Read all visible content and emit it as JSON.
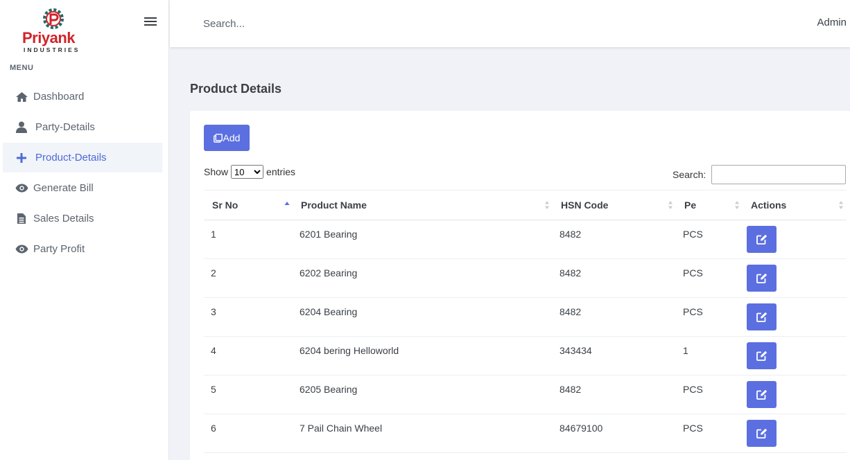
{
  "brand": {
    "name": "Priyank",
    "tagline": "INDUSTRIES",
    "primary_color": "#d1232a",
    "gear_color": "#1d6b6b"
  },
  "sidebar": {
    "menu_title": "MENU",
    "items": [
      {
        "label": "Dashboard",
        "icon": "home-icon",
        "active": false
      },
      {
        "label": "Party-Details",
        "icon": "user-icon",
        "active": false
      },
      {
        "label": "Product-Details",
        "icon": "plus-icon",
        "active": true
      },
      {
        "label": "Generate Bill",
        "icon": "eye-icon",
        "active": false
      },
      {
        "label": "Sales Details",
        "icon": "file-icon",
        "active": false
      },
      {
        "label": "Party Profit",
        "icon": "eye-icon",
        "active": false
      }
    ]
  },
  "topbar": {
    "search_placeholder": "Search...",
    "user": "Admin"
  },
  "main": {
    "title": "Product Details",
    "add_label": "Add",
    "show_label": "Show",
    "entries_label": "entries",
    "page_size": "10",
    "search_label": "Search:",
    "columns": [
      "Sr No",
      "Product Name",
      "HSN Code",
      "Pe",
      "Actions"
    ],
    "rows": [
      [
        "1",
        "6201 Bearing",
        "8482",
        "PCS"
      ],
      [
        "2",
        "6202 Bearing",
        "8482",
        "PCS"
      ],
      [
        "3",
        "6204 Bearing",
        "8482",
        "PCS"
      ],
      [
        "4",
        "6204 bering Helloworld",
        "343434",
        "1"
      ],
      [
        "5",
        "6205 Bearing",
        "8482",
        "PCS"
      ],
      [
        "6",
        "7 Pail Chain Wheel",
        "84679100",
        "PCS"
      ]
    ]
  },
  "colors": {
    "accent": "#5b6fe0",
    "active_nav": "#4d6ad6"
  }
}
